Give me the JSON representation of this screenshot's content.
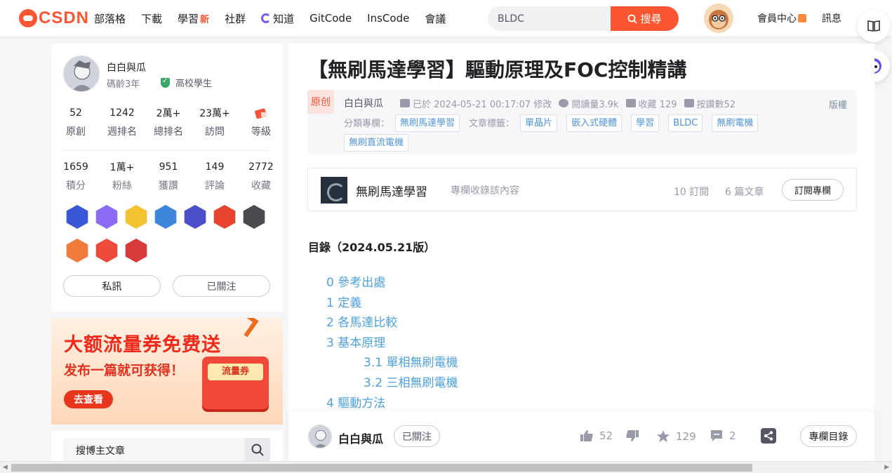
{
  "brand": {
    "logo_text": "CSDN",
    "accent": "#fc5531"
  },
  "nav": {
    "items": [
      "部落格",
      "下載",
      "學習",
      "社群",
      "知道",
      "GitCode",
      "InsCode",
      "會議"
    ],
    "learn_badge": "新"
  },
  "search": {
    "value": "BLDC",
    "button": "搜尋"
  },
  "top_right": {
    "vip": "會員中心",
    "messages": "訊息"
  },
  "profile": {
    "name": "白白與瓜",
    "code_age": "碼齡3年",
    "school": "高校學生",
    "stats_top": [
      {
        "value": "52",
        "label": "原創"
      },
      {
        "value": "1242",
        "label": "週排名"
      },
      {
        "value": "2萬+",
        "label": "總排名"
      },
      {
        "value": "23萬+",
        "label": "訪問"
      },
      {
        "value": "",
        "label": "等級"
      }
    ],
    "stats_bottom": [
      {
        "value": "1659",
        "label": "積分"
      },
      {
        "value": "1萬+",
        "label": "粉絲"
      },
      {
        "value": "951",
        "label": "獲讚"
      },
      {
        "value": "149",
        "label": "評論"
      },
      {
        "value": "2772",
        "label": "收藏"
      }
    ],
    "badge_colors": [
      "#3a57d6",
      "#8a6cf5",
      "#f2c230",
      "#3d86d9",
      "#4a4fc9",
      "#e8432e",
      "#4a4a4f",
      "#ef7a3a",
      "#ef4a3a",
      "#d93a3a"
    ],
    "message_button": "私訊",
    "followed_button": "已關注"
  },
  "promo": {
    "headline": "大额流量券免费送",
    "subline": "发布一篇就可获得！",
    "cta": "去查看",
    "coupon_label": "流量券"
  },
  "sidebar_search": {
    "placeholder": "搜博主文章"
  },
  "article": {
    "title": "【無刷馬達學習】驅動原理及FOC控制精講",
    "original_badge": "原创",
    "author": "白白與瓜",
    "updated": "已於 2024-05-21 00:17:07 修改",
    "reads": "閱讀量3.9k",
    "favorites": "收藏 129",
    "likes": "按讚數52",
    "copyright": "版權",
    "category_label": "分類專欄：",
    "categories": [
      "無刷馬達學習"
    ],
    "tags_label": "文章標籤：",
    "tags": [
      "單晶片",
      "嵌入式硬體",
      "學習",
      "BLDC",
      "無刷電機",
      "無刷直流電機"
    ]
  },
  "column": {
    "name": "無刷馬達學習",
    "desc": "專欄收錄該內容",
    "subscribers": "10 訂閱",
    "articles": "6 篇文章",
    "subscribe_button": "訂閱專欄"
  },
  "toc": {
    "title": "目錄（2024.05.21版）",
    "items": [
      {
        "text": "0 參考出處",
        "level": 1
      },
      {
        "text": "1 定義",
        "level": 1
      },
      {
        "text": "2 各馬達比較",
        "level": 1
      },
      {
        "text": "3 基本原理",
        "level": 1
      },
      {
        "text": "3.1 單相無刷電機",
        "level": 2
      },
      {
        "text": "3.2 三相無刷電機",
        "level": 2
      },
      {
        "text": "4 驅動方法",
        "level": 1
      }
    ]
  },
  "bottom_bar": {
    "author": "白白與瓜",
    "follow": "已關注",
    "likes": "52",
    "favorites": "129",
    "comments": "2",
    "column_toc": "專欄目錄"
  }
}
